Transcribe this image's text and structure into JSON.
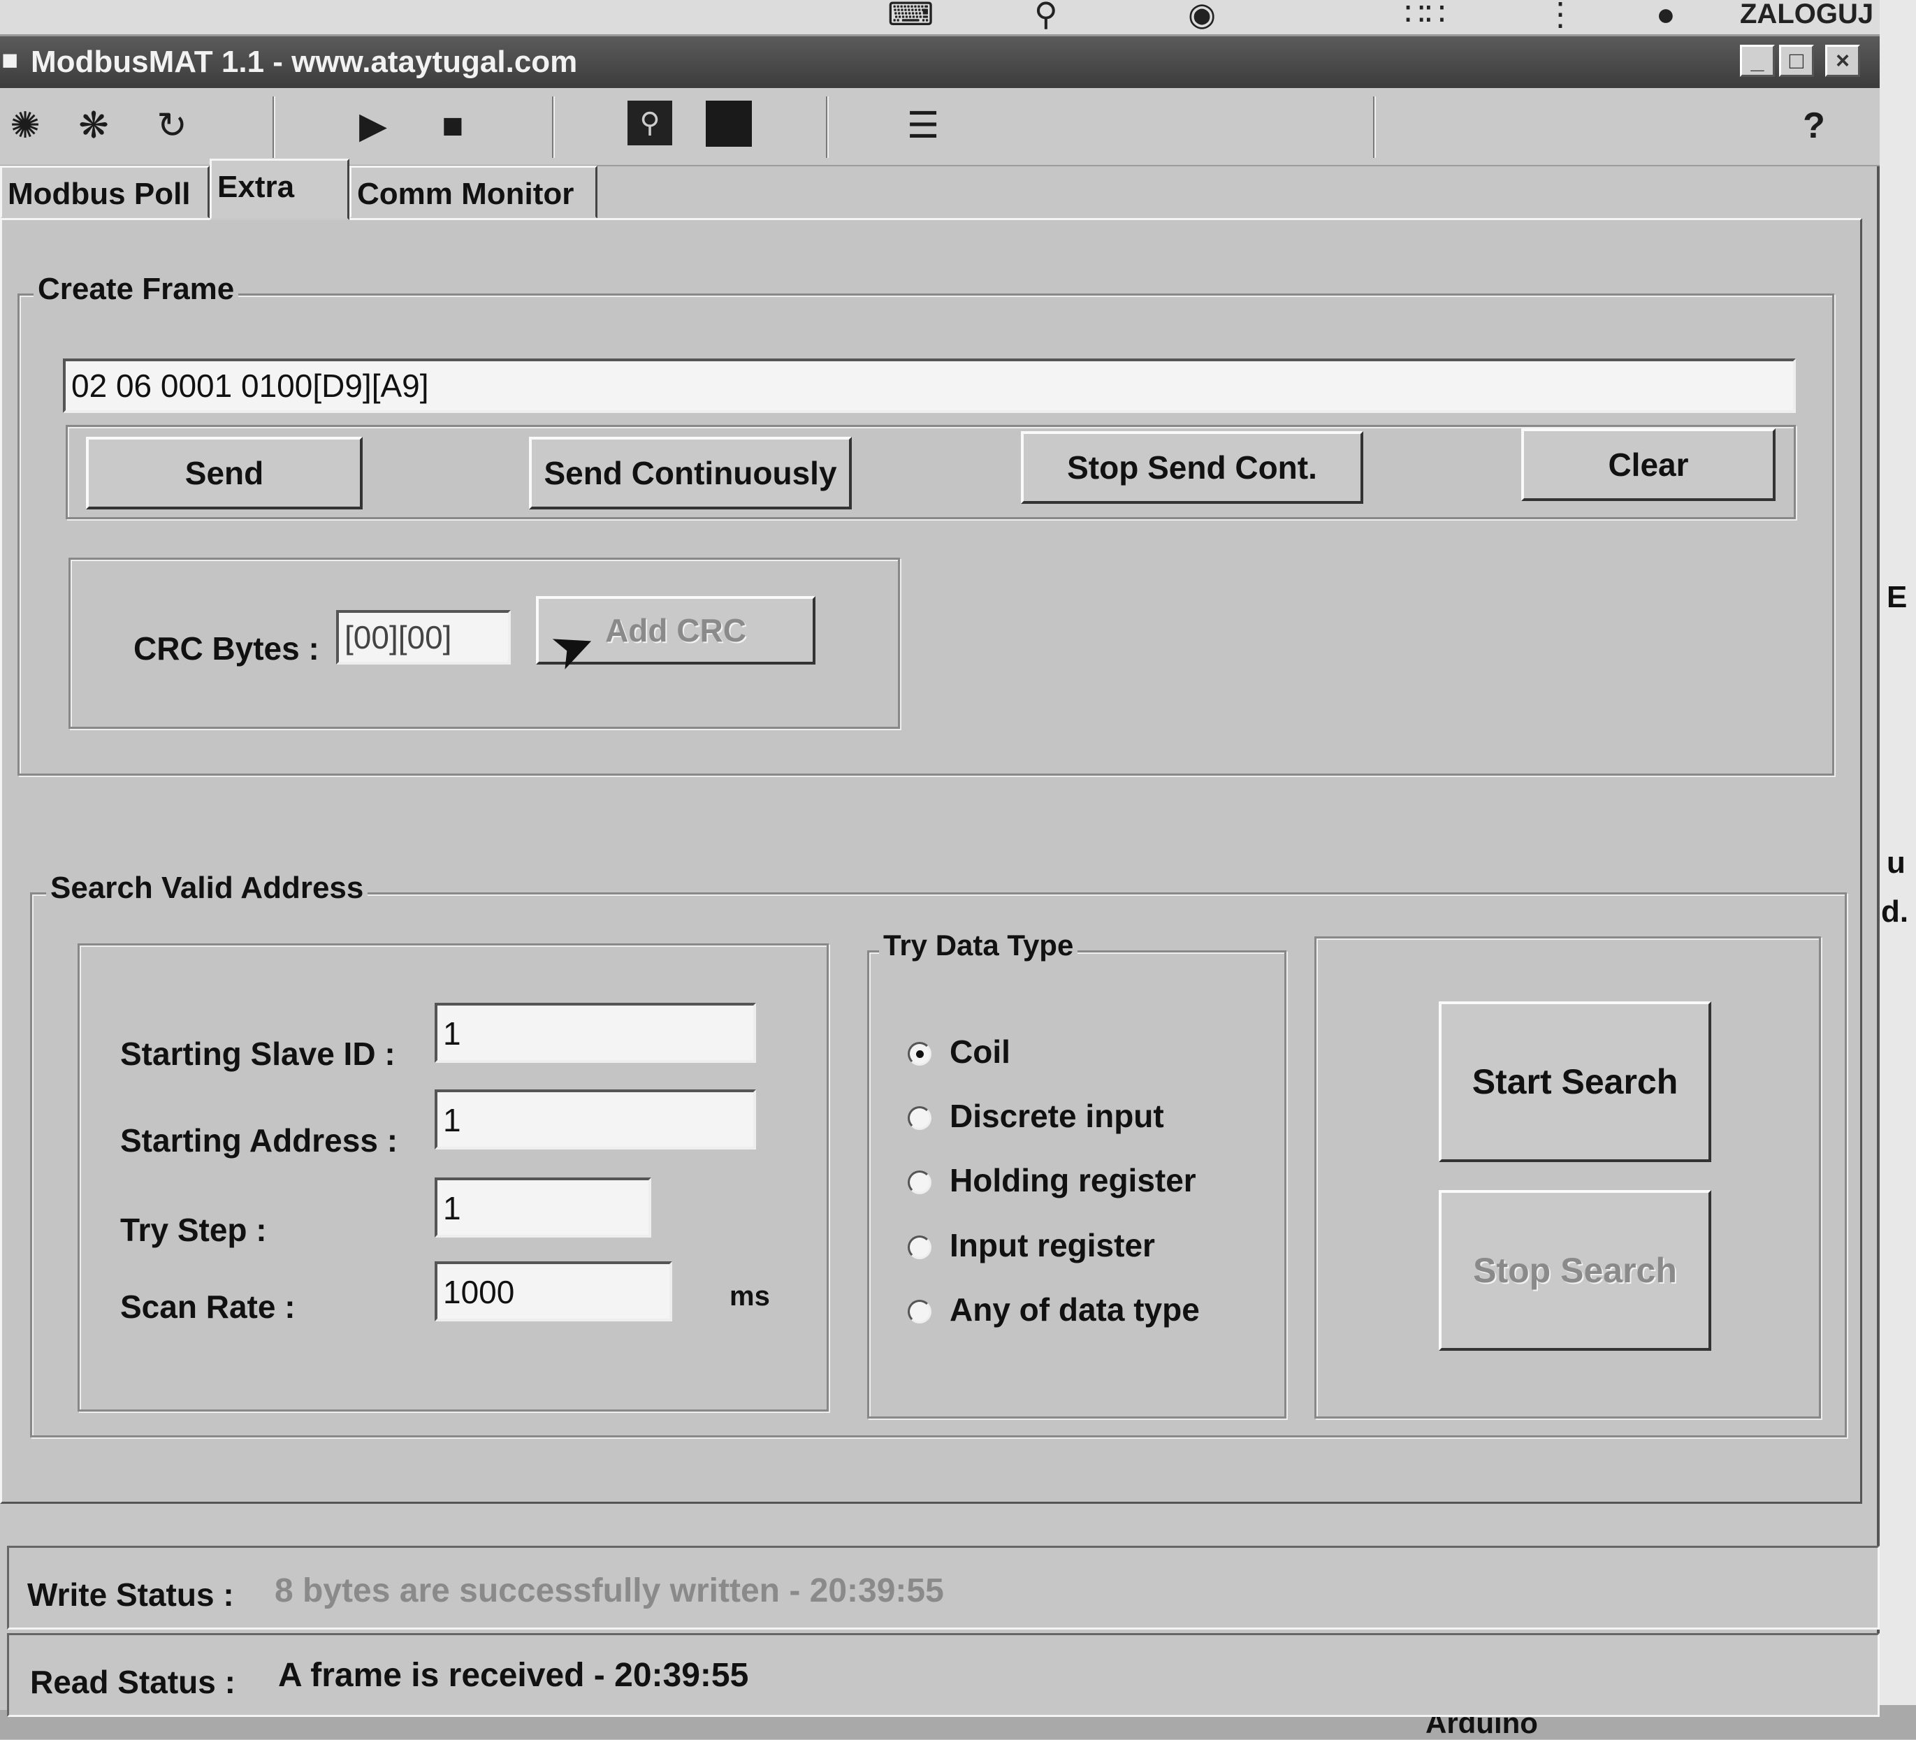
{
  "desktop": {
    "top_right_text": "ZALOGUJ",
    "side_text_e": "E",
    "side_text_u": "u",
    "side_text_d": "d.",
    "bottom_text": "Arduino"
  },
  "window": {
    "title": "ModbusMAT 1.1  -  www.ataytugal.com"
  },
  "toolbar": {
    "help_label": "?"
  },
  "tabs": [
    {
      "label": "Modbus Poll",
      "active": false
    },
    {
      "label": "Extra",
      "active": true
    },
    {
      "label": "Comm Monitor",
      "active": false
    }
  ],
  "create_frame": {
    "legend": "Create Frame",
    "frame_value": "02 06 0001 0100[D9][A9]",
    "send_label": "Send",
    "send_continuously_label": "Send Continuously",
    "stop_send_cont_label": "Stop Send Cont.",
    "clear_label": "Clear",
    "crc_label": "CRC Bytes :",
    "crc_value": "[00][00]",
    "add_crc_label": "Add CRC"
  },
  "search": {
    "legend": "Search Valid Address",
    "starting_slave_id_label": "Starting Slave ID :",
    "starting_slave_id_value": "1",
    "starting_address_label": "Starting Address :",
    "starting_address_value": "1",
    "try_step_label": "Try Step :",
    "try_step_value": "1",
    "scan_rate_label": "Scan Rate :",
    "scan_rate_value": "1000",
    "scan_rate_unit": "ms",
    "data_type_legend": "Try Data Type",
    "data_types": [
      {
        "label": "Coil",
        "selected": true
      },
      {
        "label": "Discrete input",
        "selected": false
      },
      {
        "label": "Holding register",
        "selected": false
      },
      {
        "label": "Input register",
        "selected": false
      },
      {
        "label": "Any of data type",
        "selected": false
      }
    ],
    "start_search_label": "Start Search",
    "stop_search_label": "Stop Search"
  },
  "status": {
    "write_label": "Write Status :",
    "write_value": "8 bytes are successfully written - 20:39:55",
    "read_label": "Read Status :",
    "read_value": "A frame is received - 20:39:55"
  },
  "icons": [
    "connect-icon",
    "disconnect-icon",
    "reconnect-icon",
    "play-icon",
    "stop-icon",
    "search-icon",
    "stop-square-icon",
    "list-icon",
    "help-icon",
    "mouse-cursor-icon"
  ]
}
